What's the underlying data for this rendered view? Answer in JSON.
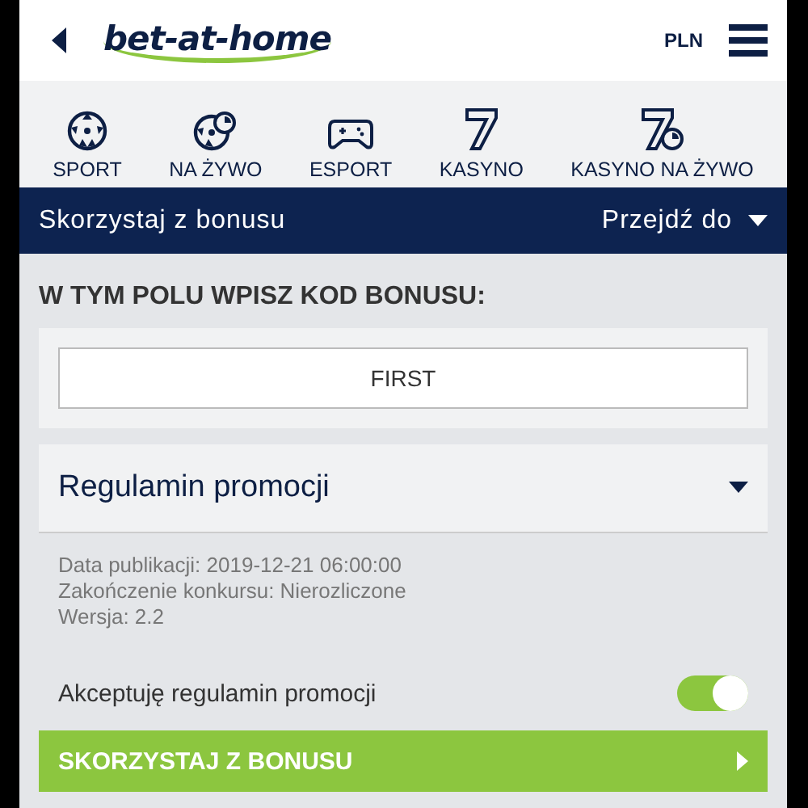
{
  "header": {
    "logo": "bet-at-home",
    "currency": "PLN"
  },
  "nav": [
    {
      "label": "SPORT",
      "kind": "ball"
    },
    {
      "label": "NA ŻYWO",
      "kind": "live-ball"
    },
    {
      "label": "ESPORT",
      "kind": "gamepad"
    },
    {
      "label": "KASYNO",
      "kind": "seven"
    },
    {
      "label": "KASYNO NA ŻYWO",
      "kind": "live-seven"
    }
  ],
  "title_bar": {
    "title": "Skorzystaj z bonusu",
    "jump": "Przejdź do"
  },
  "bonus": {
    "heading": "W TYM POLU WPISZ KOD BONUSU:",
    "code": "FIRST"
  },
  "terms": {
    "title": "Regulamin promocji",
    "expanded": false,
    "details": [
      "Data publikacji: 2019-12-21 06:00:00",
      "Zakończenie konkursu: Nierozliczone",
      "Wersja: 2.2"
    ]
  },
  "accept": {
    "label": "Akceptuję regulamin promocji",
    "on": true
  },
  "submit": "SKORZYSTAJ Z BONUSU"
}
